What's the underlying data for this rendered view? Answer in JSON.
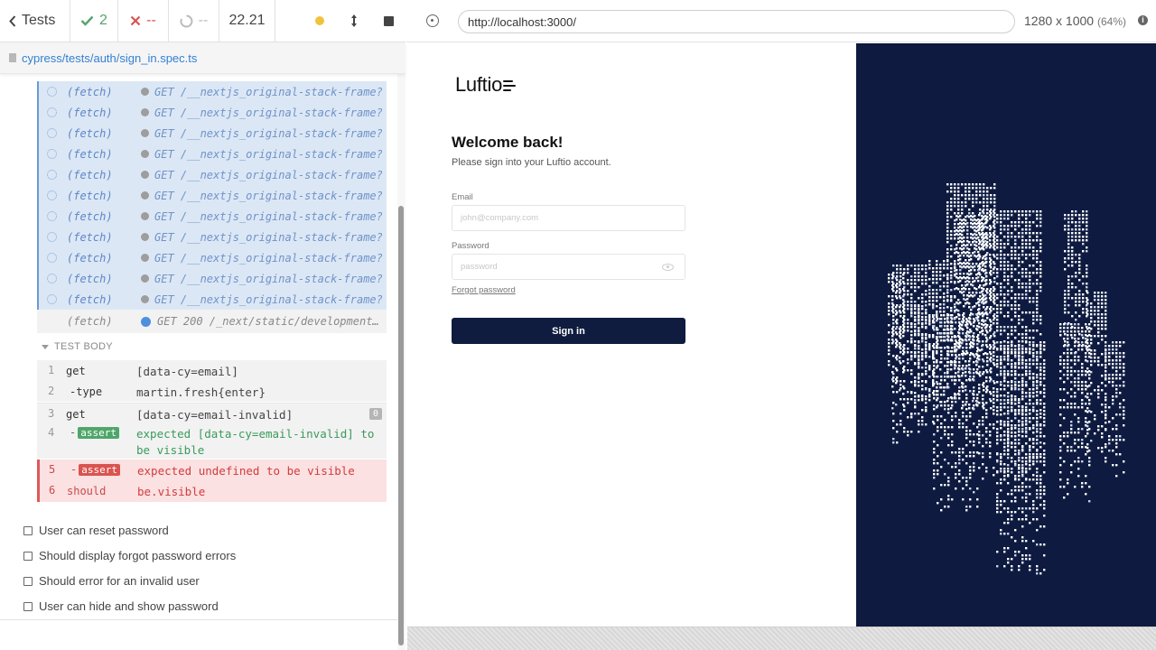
{
  "reporter": {
    "back_label": "Tests",
    "passed_count": "2",
    "failed_count": "--",
    "pending_count": "--",
    "duration": "22.21",
    "spec_path": "cypress/tests/auth/sign_in.spec.ts",
    "requests": [
      {
        "name": "(fetch)",
        "message": "GET /__nextjs_original-stack-frame?isSer…"
      },
      {
        "name": "(fetch)",
        "message": "GET /__nextjs_original-stack-frame?isSer…"
      },
      {
        "name": "(fetch)",
        "message": "GET /__nextjs_original-stack-frame?isSer…"
      },
      {
        "name": "(fetch)",
        "message": "GET /__nextjs_original-stack-frame?isSer…"
      },
      {
        "name": "(fetch)",
        "message": "GET /__nextjs_original-stack-frame?isSer…"
      },
      {
        "name": "(fetch)",
        "message": "GET /__nextjs_original-stack-frame?isSer…"
      },
      {
        "name": "(fetch)",
        "message": "GET /__nextjs_original-stack-frame?isSer…"
      },
      {
        "name": "(fetch)",
        "message": "GET /__nextjs_original-stack-frame?isSer…"
      },
      {
        "name": "(fetch)",
        "message": "GET /__nextjs_original-stack-frame?isSer…"
      },
      {
        "name": "(fetch)",
        "message": "GET /__nextjs_original-stack-frame?isSer…"
      },
      {
        "name": "(fetch)",
        "message": "GET /__nextjs_original-stack-frame?isSer…"
      }
    ],
    "done_request": {
      "name": "(fetch)",
      "message": "GET 200 /_next/static/development…"
    },
    "test_body_label": "TEST BODY",
    "commands": [
      {
        "num": "1",
        "cmd": "get",
        "msg": "[data-cy=email]"
      },
      {
        "num": "2",
        "cmd": "-type",
        "msg": "martin.fresh{enter}"
      },
      {
        "num": "3",
        "cmd": "get",
        "msg": "[data-cy=email-invalid]",
        "badge": "0"
      },
      {
        "num": "4",
        "cmd_prefix": "-",
        "cmd": "assert",
        "msg": "expected [data-cy=email-invalid] to\nbe visible"
      },
      {
        "num": "5",
        "cmd_prefix": "-",
        "cmd": "assert",
        "msg": "expected undefined to be visible"
      },
      {
        "num": "6",
        "cmd": "should",
        "msg": "be.visible"
      }
    ],
    "pending_tests": [
      "User can reset password",
      "Should display forgot password errors",
      "Should error for an invalid user",
      "User can hide and show password"
    ]
  },
  "aut": {
    "url": "http://localhost:3000/",
    "viewport": "1280 x 1000",
    "scale": "(64%)",
    "info": "i"
  },
  "app": {
    "logo": "Luftio",
    "heading": "Welcome back!",
    "subheading": "Please sign into your Luftio account.",
    "email_label": "Email",
    "email_placeholder": "john@company.com",
    "password_label": "Password",
    "password_placeholder": "password",
    "forgot_link": "Forgot password",
    "signin_label": "Sign in"
  },
  "colors": {
    "brand_navy": "#0e1a3f",
    "pass_green": "#4fa66b",
    "fail_red": "#d9534f",
    "link_blue": "#3380d4"
  }
}
